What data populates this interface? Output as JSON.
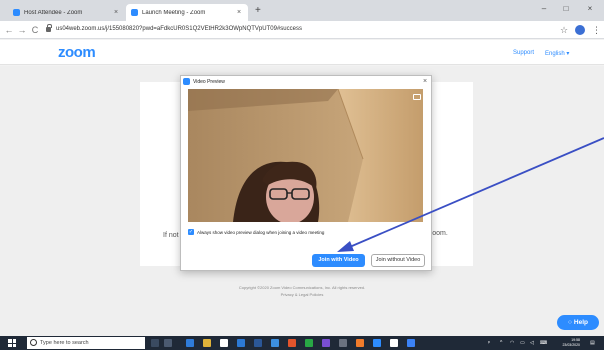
{
  "browser": {
    "tabs": [
      {
        "label": "Host Attendee - Zoom"
      },
      {
        "label": "Launch Meeting - Zoom"
      }
    ],
    "url": "us04web.zoom.us/j/155080820?pwd=aFdkcUR0S1Q2VEtHR2k3OWpNQTVpUT09#success"
  },
  "zoom_header": {
    "logo": "zoom",
    "support": "Support",
    "language": "English ▾"
  },
  "page": {
    "partial_left": "If not",
    "partial_right": "Zoom.",
    "copyright": "Copyright ©2020 Zoom Video Communications, Inc. All rights reserved.",
    "policies": "Privacy & Legal Policies"
  },
  "dialog": {
    "title": "Video Preview",
    "checkbox_label": "Always show video preview dialog when joining a video meeting",
    "checkbox_checked": true,
    "join_with_video": "Join with Video",
    "join_without_video": "Join without Video"
  },
  "help": {
    "label": "Help"
  },
  "taskbar": {
    "search_placeholder": "Type here to search",
    "time": "19:58",
    "date": "23/03/2020"
  },
  "colors": {
    "zoom_blue": "#2d8cff",
    "annotation_arrow": "#3a4fc4"
  }
}
